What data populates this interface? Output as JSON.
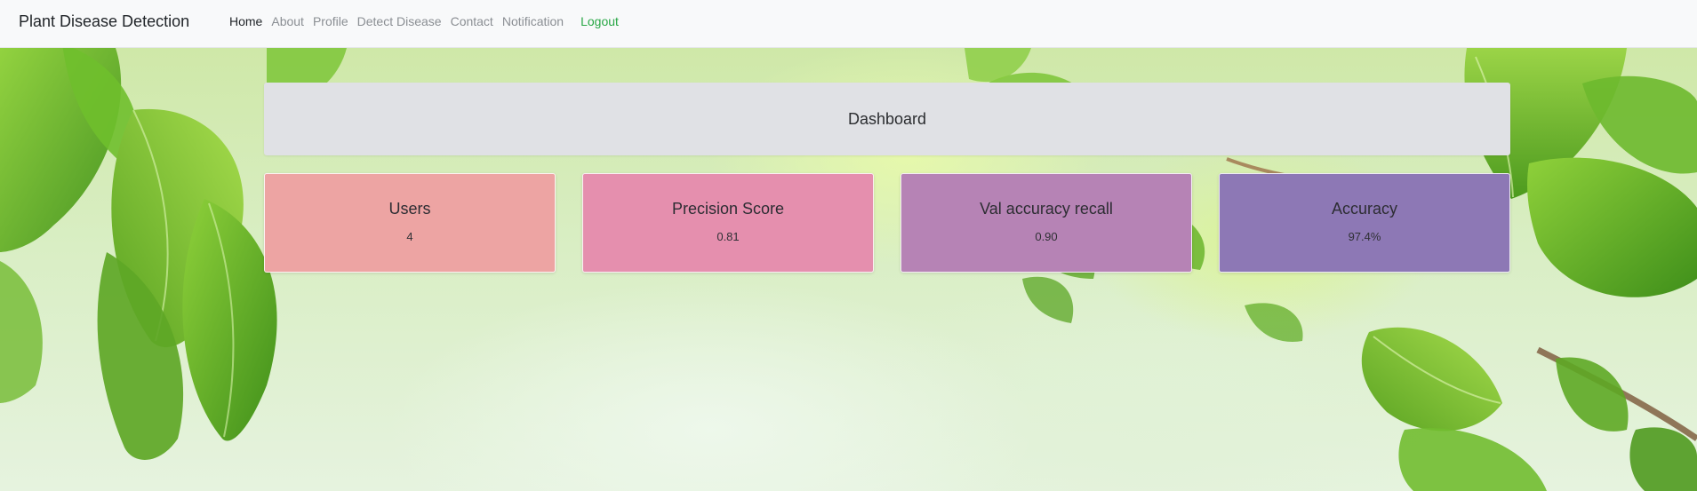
{
  "navbar": {
    "brand": "Plant Disease Detection",
    "links": [
      {
        "label": "Home"
      },
      {
        "label": "About"
      },
      {
        "label": "Profile"
      },
      {
        "label": "Detect Disease"
      },
      {
        "label": "Contact"
      },
      {
        "label": "Notification"
      }
    ],
    "logout": "Logout"
  },
  "dashboard": {
    "title": "Dashboard",
    "cards": [
      {
        "title": "Users",
        "value": "4",
        "color": "#eda4a3"
      },
      {
        "title": "Precision Score",
        "value": "0.81",
        "color": "#e58fae"
      },
      {
        "title": "Val accuracy recall",
        "value": "0.90",
        "color": "#b683b5"
      },
      {
        "title": "Accuracy",
        "value": "97.4%",
        "color": "#8d78b5"
      }
    ]
  },
  "colors": {
    "navbar_bg": "#f8f9fa",
    "active_link": "#1f2327",
    "muted_link": "#8a8e93",
    "logout_link": "#28a745",
    "header_bg": "#e0e1e5"
  }
}
